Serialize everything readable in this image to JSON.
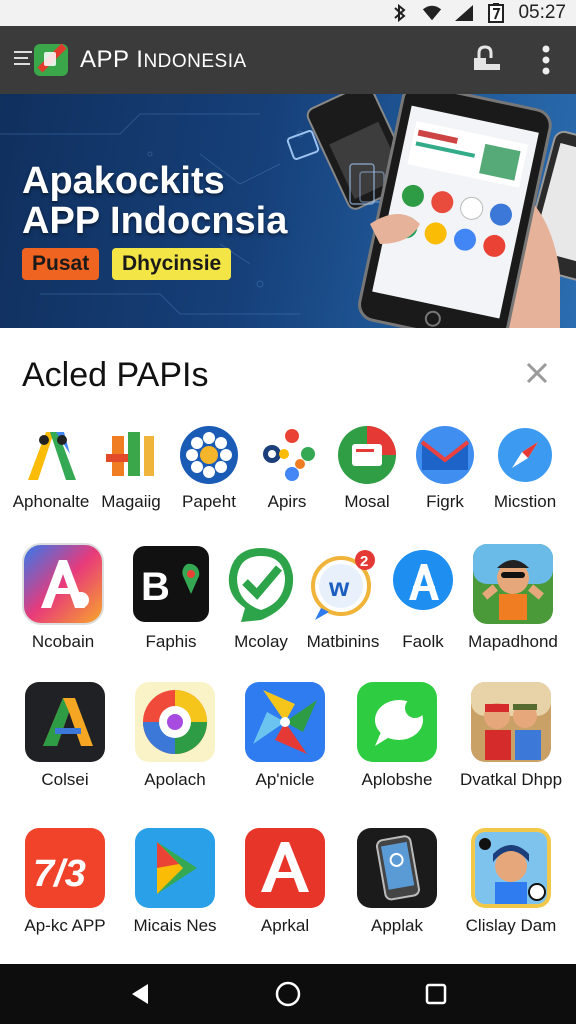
{
  "status_bar": {
    "time": "05:27"
  },
  "app_bar": {
    "title_main": "APP I",
    "title_small": "NDONESIA"
  },
  "banner": {
    "line1": "Apakockits",
    "line2": "APP Indocnsia",
    "badge1": "Pusat",
    "badge2": "Dhycinsie"
  },
  "section": {
    "title": "Acled PAPIs"
  },
  "rows": {
    "r1": [
      "Aphonalte",
      "Magaiig",
      "Papeht",
      "Apirs",
      "Mosal",
      "Figrk",
      "Micstion"
    ],
    "r2": [
      "Ncobain",
      "Faphis",
      "Mcolay",
      "Matbinins",
      "Faolk",
      "Mapadhond"
    ],
    "r3": [
      "Colsei",
      "Apolach",
      "Ap'nicle",
      "Aplobshe",
      "Dvatkal Dhpp"
    ],
    "r4": [
      "Ap-kc APP",
      "Micais Nes",
      "Aprkal",
      "Applak",
      "Clislay Dam"
    ]
  },
  "icon_text": {
    "bv": "B",
    "seven": "7/3",
    "w": "w",
    "w_badge": "2"
  },
  "colors": {
    "app_bar": "#3b3b3b",
    "banner": "#16407a",
    "badge_orange": "#f06421",
    "badge_yellow": "#f2e545",
    "nav_bar": "#0d0d0d"
  }
}
